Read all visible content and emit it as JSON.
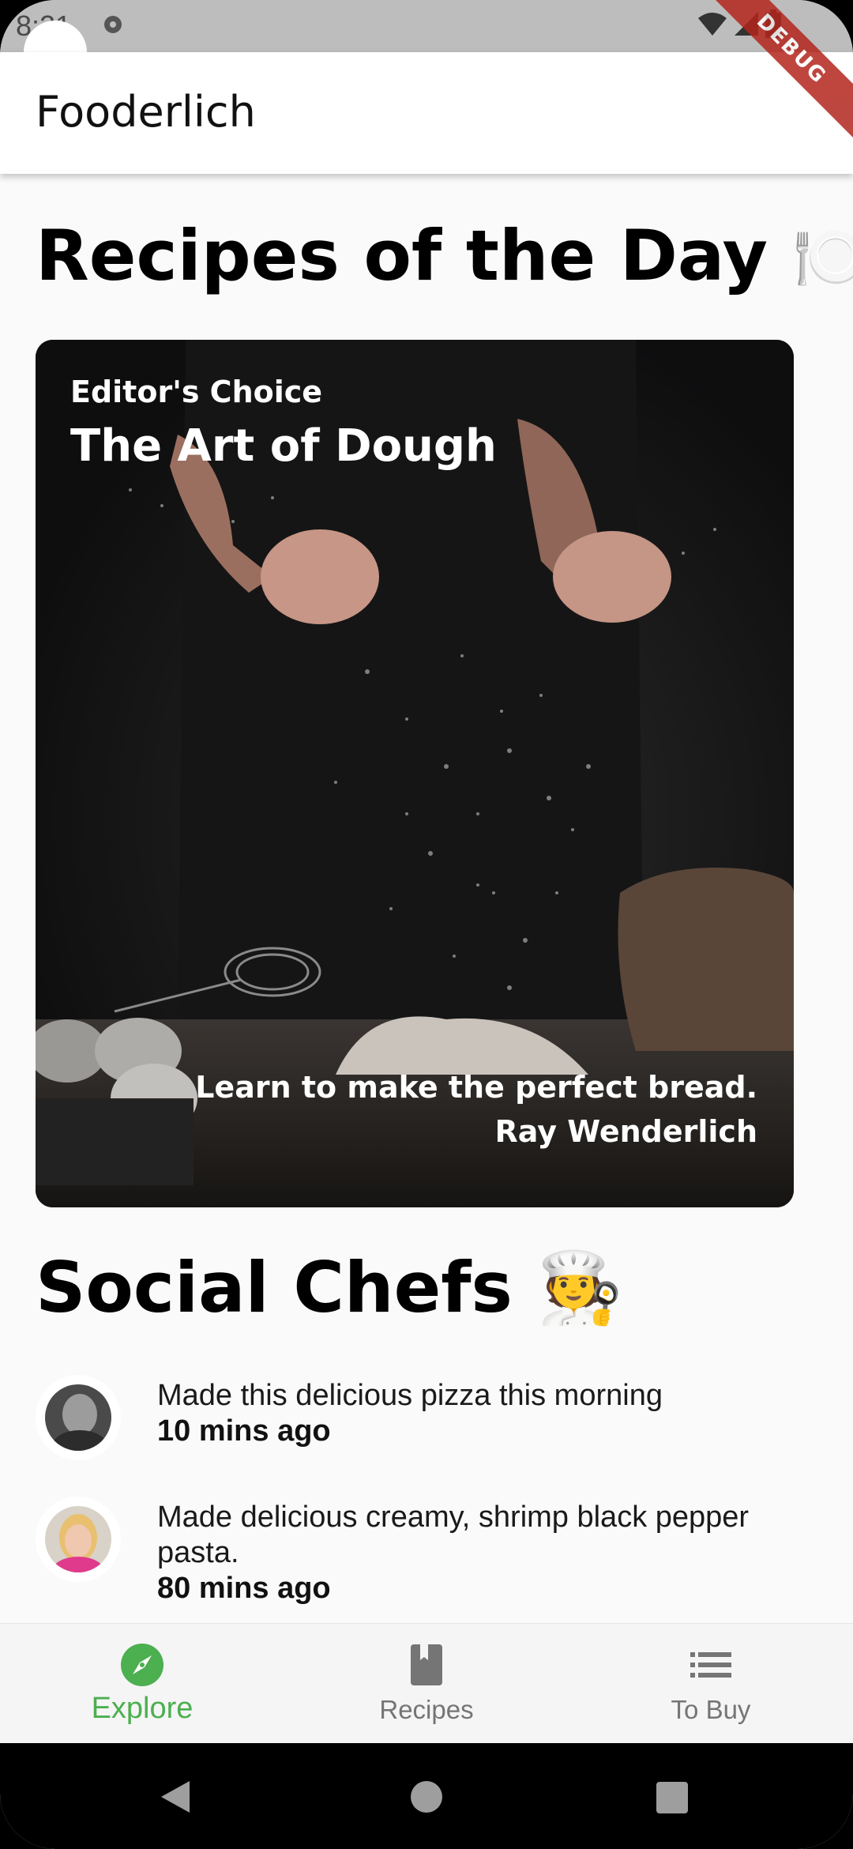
{
  "status_bar": {
    "time": "8:21"
  },
  "debug_banner": "DEBUG",
  "app_bar": {
    "title": "Fooderlich"
  },
  "recipes_section": {
    "title": "Recipes of the Day 🍽️"
  },
  "recipe_card": {
    "category": "Editor's Choice",
    "title": "The Art of Dough",
    "description": "Learn to make the perfect bread.",
    "author": "Ray Wenderlich"
  },
  "social_section": {
    "title": "Social Chefs 🧑‍🍳"
  },
  "feed": [
    {
      "message": "Made this delicious pizza this morning",
      "time": "10 mins ago"
    },
    {
      "message": "Made delicious creamy, shrimp black pepper pasta.",
      "time": "80 mins ago"
    }
  ],
  "bottom_nav": {
    "items": [
      {
        "label": "Explore",
        "icon": "compass-icon",
        "active": true
      },
      {
        "label": "Recipes",
        "icon": "book-icon",
        "active": false
      },
      {
        "label": "To Buy",
        "icon": "list-icon",
        "active": false
      }
    ]
  },
  "colors": {
    "accent": "#4caf50",
    "debug": "#b3261e",
    "inactive": "#757575"
  }
}
